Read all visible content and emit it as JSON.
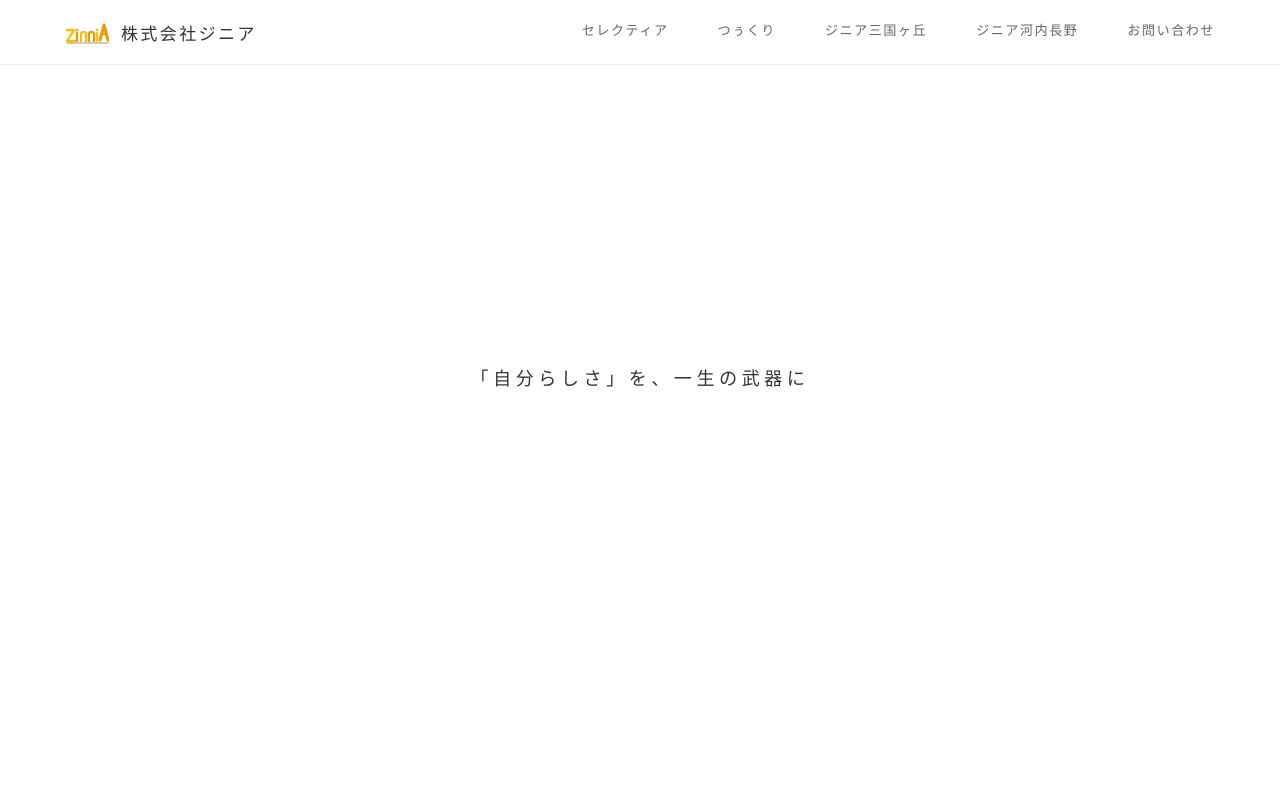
{
  "header": {
    "logo_text": "ZinniA",
    "company_name": "株式会社ジニア",
    "nav": [
      {
        "label": "セレクティア"
      },
      {
        "label": "つぅくり"
      },
      {
        "label": "ジニア三国ヶ丘"
      },
      {
        "label": "ジニア河内長野"
      },
      {
        "label": "お問い合わせ"
      }
    ]
  },
  "hero": {
    "tagline": "「自分らしさ」を、一生の武器に"
  },
  "colors": {
    "logo_orange": "#f39800",
    "logo_yellow": "#f5c400",
    "text_dark": "#333333",
    "nav_text": "#666666",
    "divider": "#eeeeee"
  }
}
